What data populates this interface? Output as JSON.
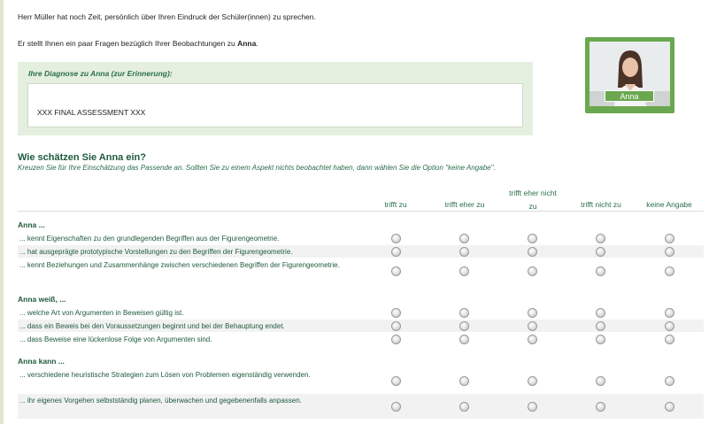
{
  "intro": {
    "line1": "Herr Müller hat noch Zeit, persönlich über Ihren Eindruck der Schüler(innen) zu sprechen.",
    "line2_prefix": "Er stellt Ihnen ein paar Fragen bezüglich Ihrer Beobachtungen zu ",
    "line2_name": "Anna",
    "line2_suffix": "."
  },
  "diagnosis": {
    "title": "Ihre Diagnose zu Anna (zur Erinnerung):",
    "text": "XXX FINAL ASSESSMENT XXX"
  },
  "avatar": {
    "name": "Anna"
  },
  "question": {
    "title": "Wie schätzen Sie Anna ein?",
    "subtitle": "Kreuzen Sie für Ihre Einschätzung das Passende an. Sollten Sie zu einem Aspekt nichts beobachtet haben, dann wählen Sie die Option \"keine Angabe\"."
  },
  "columns": [
    "trifft zu",
    "trifft eher zu",
    "trifft eher nicht zu",
    "trifft nicht zu",
    "keine Angabe"
  ],
  "columns_split": {
    "line1": "trifft eher nicht",
    "line2": "zu"
  },
  "groups": [
    {
      "label": "Anna ...",
      "items": [
        "... kennt Eigenschaften zu den grundlegenden Begriffen aus der Figurengeometrie.",
        "... hat ausgeprägte prototypische Vorstellungen zu den Begriffen der Figurengeometrie.",
        "... kennt Beziehungen und Zusammenhänge zwischen verschiedenen Begriffen der Figurengeometrie."
      ]
    },
    {
      "label": "Anna weiß, ...",
      "items": [
        "... welche Art von Argumenten in Beweisen gültig ist.",
        "... dass ein Beweis bei den Voraussetzungen beginnt und bei der Behauptung endet.",
        "... dass Beweise eine lückenlose Folge von Argumenten sind."
      ]
    },
    {
      "label": "Anna kann ...",
      "items": [
        "... verschiedene heuristische Strategien zum Lösen von Problemen eigenständig verwenden.",
        "... ihr eigenes Vorgehen selbstständig planen, überwachen und gegebenenfalls anpassen."
      ]
    }
  ]
}
